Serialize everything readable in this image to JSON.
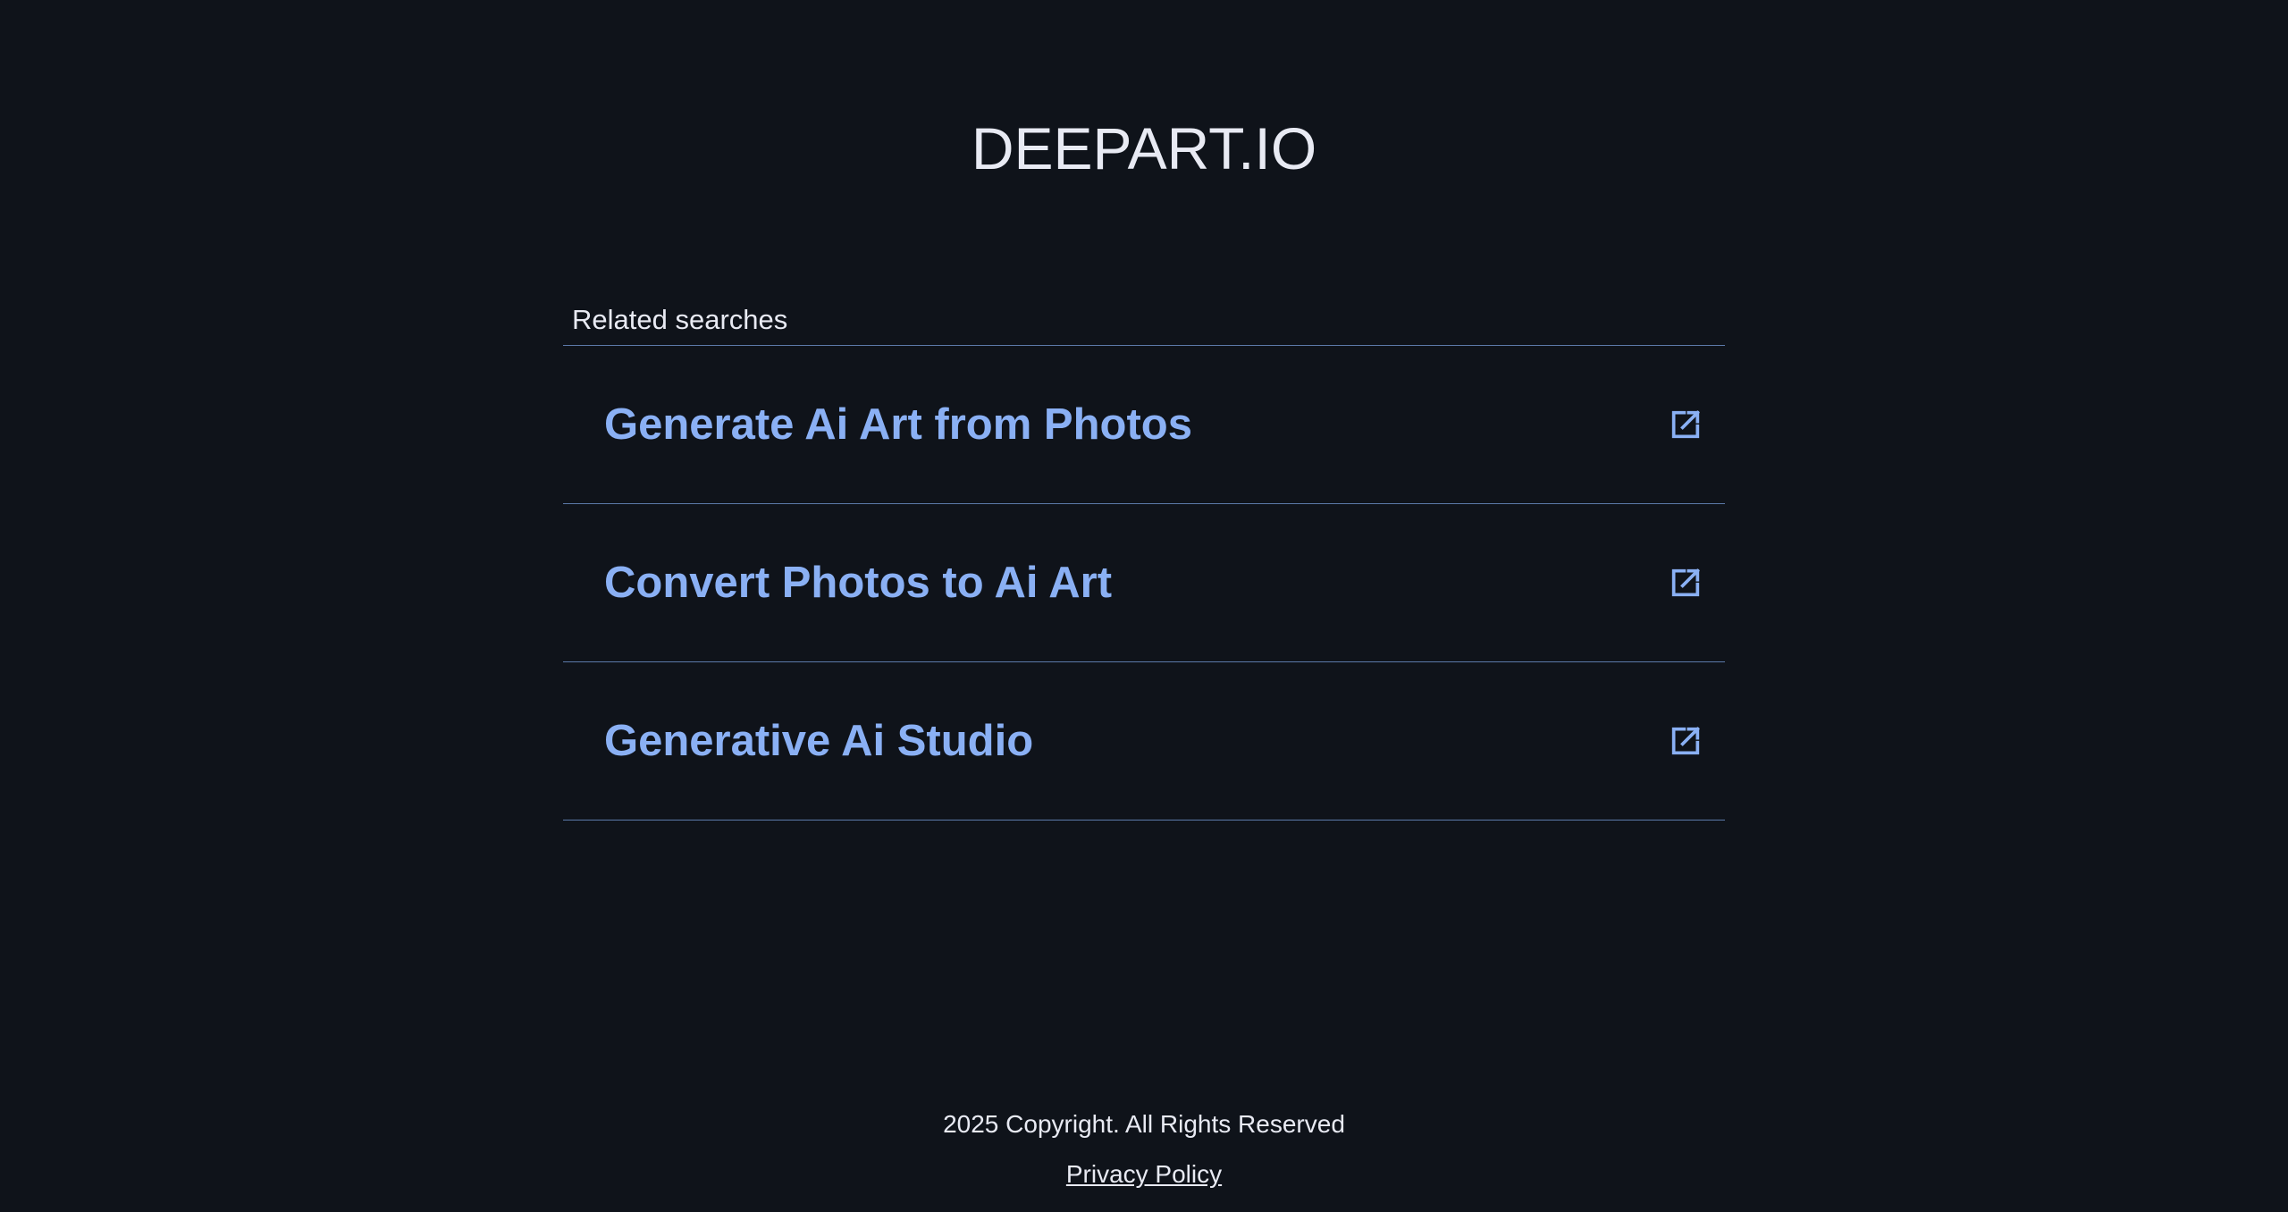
{
  "header": {
    "title": "DEEPART.IO"
  },
  "related": {
    "heading": "Related searches",
    "items": [
      {
        "label": "Generate Ai Art from Photos",
        "icon": "external-link-icon"
      },
      {
        "label": "Convert Photos to Ai Art",
        "icon": "external-link-icon"
      },
      {
        "label": "Generative Ai Studio",
        "icon": "external-link-icon"
      }
    ]
  },
  "footer": {
    "copyright": "2025 Copyright. All Rights Reserved",
    "privacy_label": "Privacy Policy"
  },
  "colors": {
    "background": "#0f131a",
    "link": "#8ab0f4",
    "divider": "#5b79a8",
    "text": "#e8eaf3"
  }
}
